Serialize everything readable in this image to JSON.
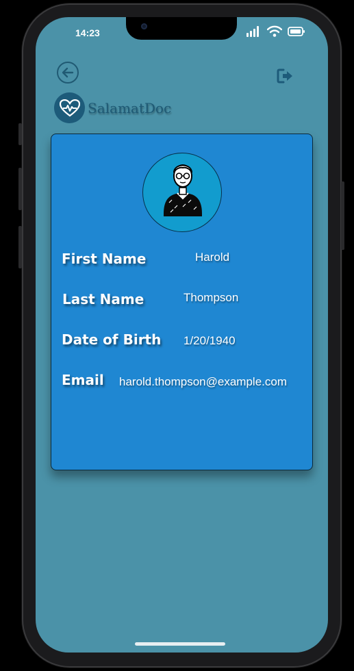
{
  "status_bar": {
    "time": "14:23",
    "icons": [
      "signal-icon",
      "wifi-icon",
      "battery-icon"
    ]
  },
  "header": {
    "back_icon": "arrow-left-circle-icon",
    "logout_icon": "logout-icon"
  },
  "brand": {
    "name": "SalamatDoc",
    "logo_icon": "heart-pulse-icon"
  },
  "profile": {
    "avatar_icon": "elderly-man-avatar",
    "fields": [
      {
        "label": "First Name",
        "value": "Harold"
      },
      {
        "label": "Last Name",
        "value": "Thompson"
      },
      {
        "label": "Date of Birth",
        "value": "1/20/1940"
      },
      {
        "label": "Email",
        "value": "harold.thompson@example.com"
      }
    ]
  },
  "colors": {
    "screen_bg": "#4b92a8",
    "card_bg": "#1f87d2",
    "avatar_bg": "#129cce",
    "brand_dark": "#1d5b7a"
  }
}
